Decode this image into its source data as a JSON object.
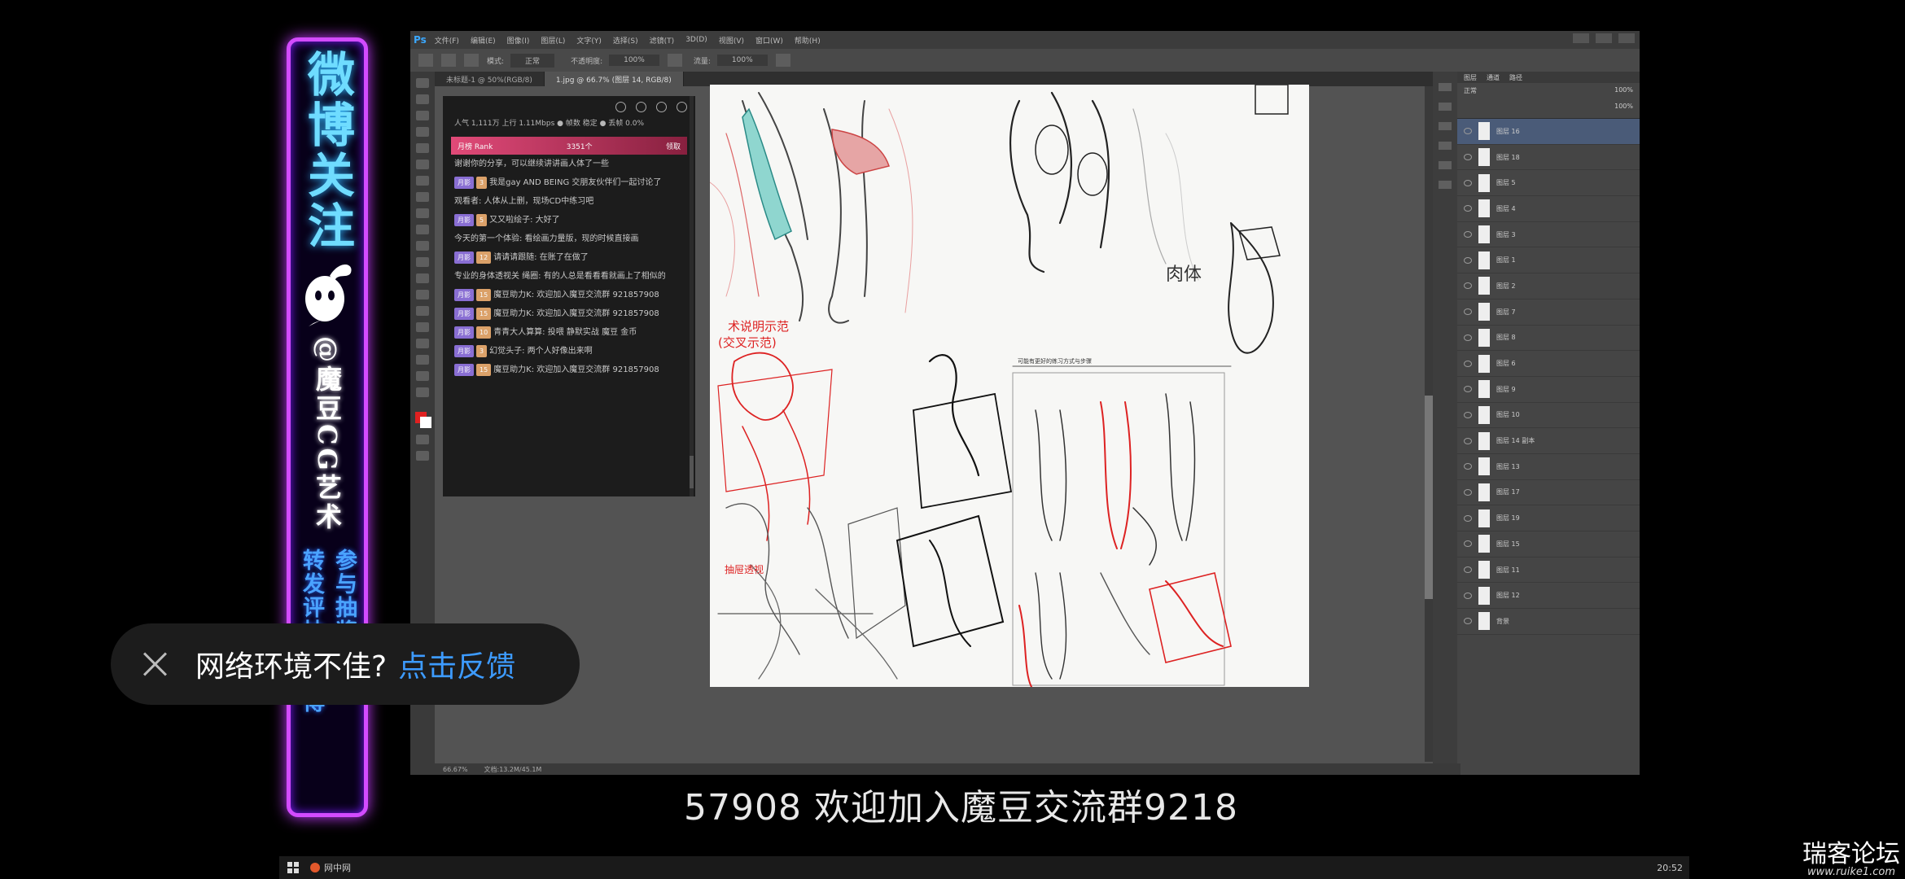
{
  "banner": {
    "title": "微博关注",
    "handle": "@魔豆CG艺术",
    "col_right": "参与抽奖活动",
    "col_left": "转发评抽奖微博"
  },
  "ps": {
    "logo": "Ps",
    "menu": [
      "文件(F)",
      "编辑(E)",
      "图像(I)",
      "图层(L)",
      "文字(Y)",
      "选择(S)",
      "滤镜(T)",
      "3D(D)",
      "视图(V)",
      "窗口(W)",
      "帮助(H)"
    ],
    "options": {
      "mode_label": "模式:",
      "mode_value": "正常",
      "opacity_label": "不透明度:",
      "opacity_value": "100%",
      "flow_label": "流量:",
      "flow_value": "100%"
    },
    "tabs": [
      "未标题-1 @ 50%(RGB/8)",
      "1.jpg @ 66.7% (图层 14, RGB/8)"
    ],
    "status": {
      "zoom": "66.67%",
      "doc": "文档:13.2M/45.1M"
    },
    "layers": {
      "tabs": [
        "图层",
        "通道",
        "路径"
      ],
      "blend": "正常",
      "opacity": "100%",
      "fill": "100%",
      "items": [
        "图层 16",
        "图层 18",
        "图层 5",
        "图层 4",
        "图层 3",
        "图层 1",
        "图层 2",
        "图层 7",
        "图层 8",
        "图层 6",
        "图层 9",
        "图层 10",
        "图层 14 副本",
        "图层 13",
        "图层 17",
        "图层 19",
        "图层 15",
        "图层 11",
        "图层 12",
        "背景"
      ]
    },
    "canvas": {
      "annotation_red_1": "术说明示范",
      "annotation_red_2": "(交叉示范)",
      "annotation_red_3": "抽屉透视",
      "annotation_black": "肉体",
      "caption": "可能有更好的练习方式与步骤"
    }
  },
  "chat": {
    "stats": "人气 1,111万  上行 1.11Mbps  ● 帧数 稳定  ● 丢帧 0.0%",
    "rank": {
      "left": "月榜 Rank",
      "center": "3351个",
      "right": "领取"
    },
    "messages": [
      {
        "badge": "",
        "text": "谢谢你的分享，可以继续讲讲画人体了一些"
      },
      {
        "badge": "月影",
        "level": "3",
        "text": "我是gay AND BEING 交朋友伙伴们一起讨论了"
      },
      {
        "badge": "",
        "text": "观看者: 人体从上删，现场CD中练习吧"
      },
      {
        "badge": "月影",
        "level": "5",
        "text": "又又啦绘子: 大好了"
      },
      {
        "badge": "",
        "text": "今天的第一个体验: 看绘画力量版，现的时候直接画"
      },
      {
        "badge": "月影",
        "level": "12",
        "text": "请请请跟随: 在账了在做了"
      },
      {
        "badge": "",
        "text": "专业的身体透视关 绳圈: 有的人总是看看看就画上了相似的"
      },
      {
        "badge": "月影",
        "level": "15",
        "text": "魔豆助力K: 欢迎加入魔豆交流群 921857908"
      },
      {
        "badge": "月影",
        "level": "15",
        "text": "魔豆助力K: 欢迎加入魔豆交流群 921857908"
      },
      {
        "badge": "月影",
        "level": "10",
        "text": "青青大人算算: 投喂 静默实战 魔豆 金币"
      },
      {
        "badge": "月影",
        "level": "3",
        "text": "幻觉头子: 两个人好像出来啊"
      },
      {
        "badge": "月影",
        "level": "15",
        "text": "魔豆助力K: 欢迎加入魔豆交流群 921857908"
      }
    ]
  },
  "toast": {
    "message": "网络环境不佳?",
    "link": "点击反馈"
  },
  "subtitle": "57908  欢迎加入魔豆交流群9218",
  "taskbar": {
    "app": "网中网",
    "clock": "20:52"
  },
  "watermark": {
    "name": "瑞客论坛",
    "url": "www.ruike1.com"
  },
  "colors": {
    "neon_border": "#d34bff",
    "neon_text": "#6fdcff",
    "toast_link": "#3d9bff",
    "ps_bg": "#535353"
  }
}
